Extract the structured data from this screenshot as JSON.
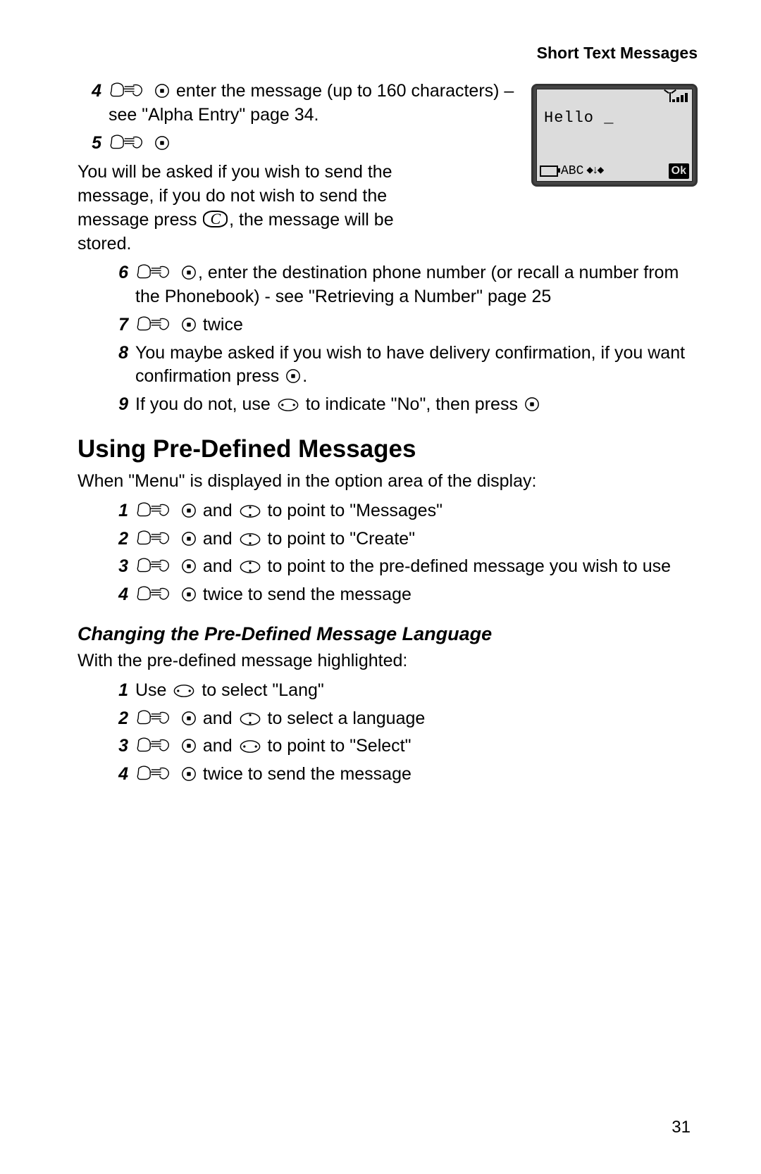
{
  "running_head": "Short Text Messages",
  "page_number": "31",
  "illus": {
    "screen_text": "Hello _",
    "mode": "ABC",
    "ok": "Ok"
  },
  "top_steps": [
    {
      "n": "4",
      "pre": "",
      "post_a": " enter the message (up to 160 characters) – see \"Alpha Entry\" page 34.",
      "has_hand": true,
      "has_ok": true
    },
    {
      "n": "5",
      "pre": "",
      "post_a": "",
      "has_hand": true,
      "has_ok": true
    }
  ],
  "mid_para_a": "You will be asked if you wish to send the message, if you do not wish to send the message press ",
  "mid_key": "C",
  "mid_para_b": ", the message will be stored.",
  "mid_steps": [
    {
      "n": "6",
      "t1": ", enter the destination phone number (or recall a number from the Phonebook) - see \"Retrieving a Number\" page 25"
    },
    {
      "n": "7",
      "t1": " twice"
    },
    {
      "n": "8",
      "plain_a": "You maybe asked if you wish to have delivery confirmation, if you want confirmation press ",
      "plain_b": "."
    },
    {
      "n": "9",
      "nine_a": "If you do not, use ",
      "nine_b": " to indicate \"No\", then press "
    }
  ],
  "section_heading": "Using Pre-Defined Messages",
  "section_intro": "When \"Menu\" is displayed in the option area of the display:",
  "sec_steps": [
    {
      "n": "1",
      "mid": " and ",
      "tail": " to point to \"Messages\""
    },
    {
      "n": "2",
      "mid": " and ",
      "tail": " to point to \"Create\""
    },
    {
      "n": "3",
      "mid": " and ",
      "tail": " to point to the pre-defined message you wish to use"
    },
    {
      "n": "4",
      "tail_only": " twice to send the message"
    }
  ],
  "subsection_heading": "Changing the Pre-Defined Message Language",
  "subsection_intro": "With the pre-defined message highlighted:",
  "sub_steps": [
    {
      "n": "1",
      "one_a": "Use ",
      "one_b": " to select \"Lang\""
    },
    {
      "n": "2",
      "mid": " and ",
      "tail": " to select a language"
    },
    {
      "n": "3",
      "mid": " and ",
      "tail": " to point to \"Select\"",
      "use_hnav": true
    },
    {
      "n": "4",
      "tail_only": " twice to send the message"
    }
  ]
}
